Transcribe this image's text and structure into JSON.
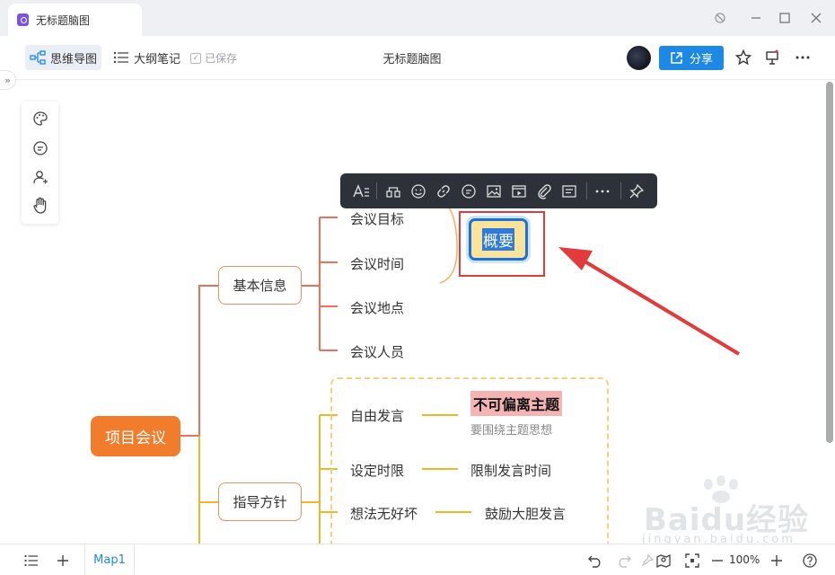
{
  "window": {
    "tab_title": "无标题脑图"
  },
  "toolbar": {
    "mindmap_label": "思维导图",
    "outline_label": "大纲笔记",
    "saved_label": "已保存",
    "doc_title": "无标题脑图",
    "share_label": "分享"
  },
  "mindmap": {
    "root": "项目会议",
    "branch1": {
      "label": "基本信息",
      "children": [
        "会议目标",
        "会议时间",
        "会议地点",
        "会议人员"
      ]
    },
    "summary": "概要",
    "branch2": {
      "label": "指导方针",
      "children": [
        {
          "label": "自由发言",
          "detail": "不可偏离主题",
          "note": "要围绕主题思想"
        },
        {
          "label": "设定时限",
          "detail": "限制发言时间"
        },
        {
          "label": "想法无好坏",
          "detail": "鼓励大胆发言"
        }
      ]
    }
  },
  "bottombar": {
    "sheet_tab": "Map1",
    "zoom": "100%"
  },
  "watermark": {
    "brand": "Baidu经验",
    "url": "jingyan.baidu.com"
  },
  "colors": {
    "root": "#f07c2c",
    "branch1_line": "#e8735a",
    "branch2_line": "#f2b52a",
    "accent": "#1e88e5",
    "annotation": "#e23b3b"
  }
}
